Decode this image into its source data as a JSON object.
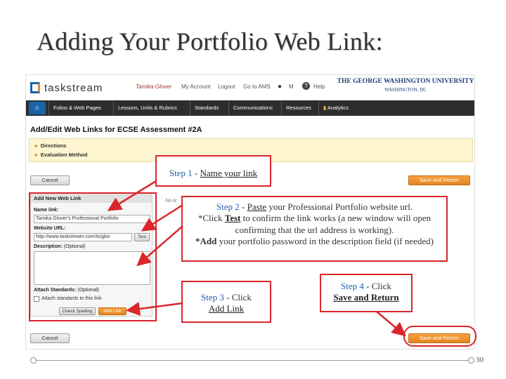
{
  "slide": {
    "title": "Adding Your Portfolio Web Link:",
    "page_number": "30"
  },
  "taskstream": {
    "brand": "taskstream",
    "user_name": "Tamika Glover",
    "links": {
      "my_account": "My Account",
      "logout": "Logout",
      "goto_ams": "Go to AMS",
      "mail": "M",
      "help_icon": "?",
      "help": "Help"
    },
    "university": {
      "line1": "THE GEORGE WASHINGTON UNIVERSITY",
      "line2": "WASHINGTON, DC"
    },
    "nav": {
      "items": [
        "Folios & Web Pages",
        "Lessons, Units & Rubrics",
        "Standards",
        "Communications",
        "Resources",
        "Analytics"
      ]
    },
    "page_heading": "Add/Edit Web Links for ECSE Assessment #2A",
    "sections": [
      "Directions",
      "Evaluation Method"
    ],
    "buttons": {
      "cancel": "Cancel",
      "save_return": "Save and Return",
      "check_spelling": "Check Spelling",
      "add_link": "Add Link"
    },
    "form": {
      "header": "Add New Web Link",
      "name_label": "Name link:",
      "name_value": "Tamika Glover's Professional Portfolio",
      "url_label": "Website URL:",
      "url_value": "http://www.taskstream.com/ts/glov",
      "test_button": "Test",
      "desc_label": "Description:",
      "desc_optional": "(Optional)",
      "attach_label": "Attach Standards:",
      "attach_optional": "(Optional)",
      "attach_check": "Attach standards to this link"
    },
    "truncated_text": "No lir"
  },
  "callouts": {
    "step1": {
      "label": "Step 1",
      "sep": " - ",
      "link": "Name your link"
    },
    "step2": {
      "label": "Step 2",
      "sep": " - ",
      "paste": "Paste",
      "line1_rest": " your Professional Portfolio website url.",
      "line2_pre": "*Click ",
      "test": "Test",
      "line2_rest": " to confirm the link works (a new window will open confirming that the url address is working).",
      "line3_pre": "*Add",
      "line3_rest": " your portfolio password in the description field (if needed)"
    },
    "step3": {
      "label": "Step 3",
      "sep": " - ",
      "action": "Click",
      "link": "Add Link"
    },
    "step4": {
      "label": "Step 4",
      "sep": " - ",
      "action": "Click",
      "link": "Save and Return"
    }
  },
  "colors": {
    "accent_red": "#d9262b",
    "taskstream_blue": "#1a63a8",
    "button_orange": "#e6841f",
    "nav_bg": "#2d2d2d",
    "step_blue": "#1f5fa8"
  }
}
